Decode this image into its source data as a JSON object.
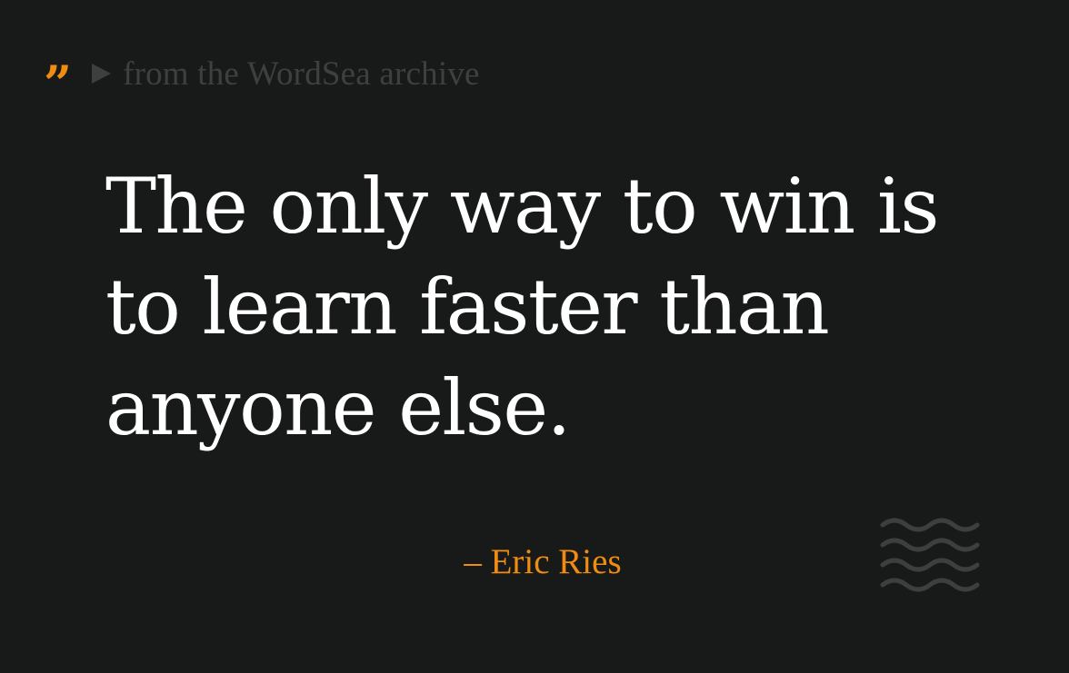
{
  "header": {
    "quote_icon": "closing-quote-mark-icon",
    "play_icon": "play-triangle-icon",
    "source_text": "from the WordSea archive"
  },
  "quote": {
    "text": "The only way to win is to learn faster than anyone else."
  },
  "author": {
    "text": "– Eric Ries"
  },
  "decoration": {
    "icon": "waves-icon"
  },
  "colors": {
    "background": "#181a1a",
    "accent": "#f08c12",
    "quote_text": "#ffffff",
    "muted": "#3e4040"
  }
}
